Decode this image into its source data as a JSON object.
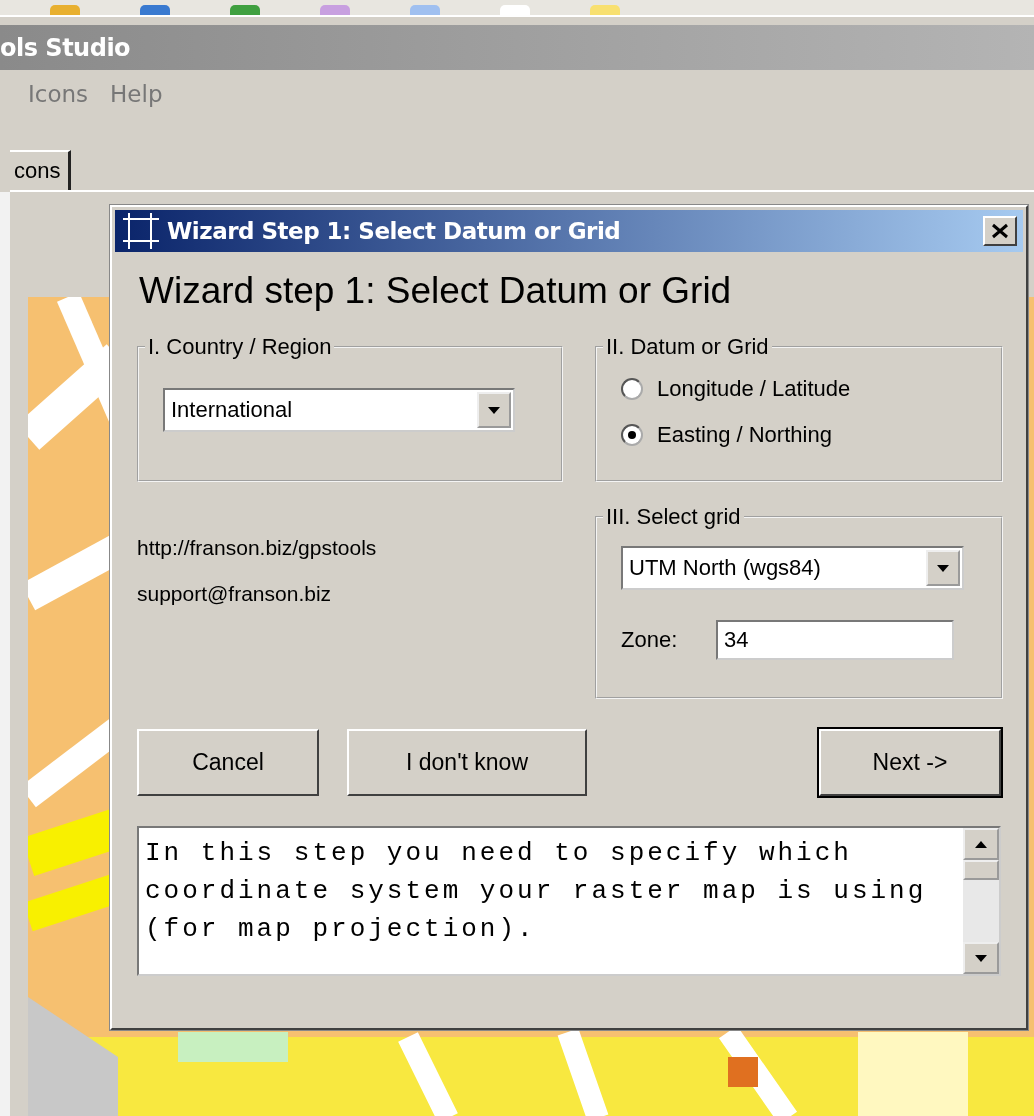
{
  "app_window": {
    "title": "ols Studio"
  },
  "menu": [
    {
      "label": "Icons"
    },
    {
      "label": "Help"
    }
  ],
  "tabs": [
    {
      "label": "cons",
      "selected": true
    }
  ],
  "dialog": {
    "title": "Wizard Step 1: Select Datum or Grid",
    "heading": "Wizard step 1: Select Datum or Grid",
    "country_group": {
      "legend": "I. Country / Region",
      "combo_value": "International"
    },
    "datum_group": {
      "legend": "II. Datum or Grid",
      "options": [
        {
          "label": "Longitude / Latitude",
          "selected": false
        },
        {
          "label": "Easting / Northing",
          "selected": true
        }
      ]
    },
    "grid_group": {
      "legend": "III. Select grid",
      "combo_value": "UTM North (wgs84)",
      "zone_label": "Zone:",
      "zone_value": "34"
    },
    "links": [
      "http://franson.biz/gpstools",
      "support@franson.biz"
    ],
    "buttons": [
      {
        "label": "Cancel",
        "default": false
      },
      {
        "label": "I don't know",
        "default": false
      },
      {
        "label": "Next ->",
        "default": true
      }
    ],
    "info_text": "In this step you need to specify which coordinate system your raster map is using (for map projection)."
  }
}
